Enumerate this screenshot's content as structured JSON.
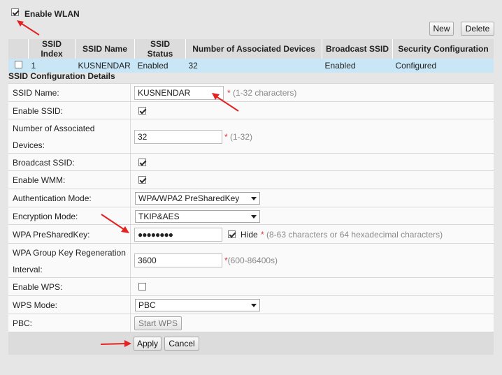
{
  "wlan": {
    "enable_label": "Enable WLAN",
    "enabled": true
  },
  "toolbar": {
    "new_label": "New",
    "delete_label": "Delete"
  },
  "ssid_table": {
    "headers": [
      "SSID Index",
      "SSID Name",
      "SSID Status",
      "Number of Associated Devices",
      "Broadcast SSID",
      "Security Configuration"
    ],
    "rows": [
      {
        "index": "1",
        "name": "KUSNENDAR",
        "status": "Enabled",
        "devices": "32",
        "broadcast": "Enabled",
        "security": "Configured"
      }
    ]
  },
  "details": {
    "title": "SSID Configuration Details",
    "ssid_name": {
      "label": "SSID Name:",
      "value": "KUSNENDAR",
      "hint": "(1-32 characters)"
    },
    "enable_ssid": {
      "label": "Enable SSID:",
      "checked": true
    },
    "assoc_devices": {
      "label_line1": "Number of Associated",
      "label_line2": "Devices:",
      "value": "32",
      "hint": "(1-32)"
    },
    "broadcast_ssid": {
      "label": "Broadcast SSID:",
      "checked": true
    },
    "enable_wmm": {
      "label": "Enable WMM:",
      "checked": true
    },
    "auth_mode": {
      "label": "Authentication Mode:",
      "value": "WPA/WPA2 PreSharedKey"
    },
    "encryption_mode": {
      "label": "Encryption Mode:",
      "value": "TKIP&AES"
    },
    "psk": {
      "label": "WPA PreSharedKey:",
      "value": "●●●●●●●●",
      "hide_label": "Hide",
      "hint": "(8-63 characters or 64 hexadecimal characters)"
    },
    "group_key": {
      "label_line1": "WPA Group Key Regeneration",
      "label_line2": "Interval:",
      "value": "3600",
      "hint": "(600-86400s)"
    },
    "enable_wps": {
      "label": "Enable WPS:",
      "checked": false
    },
    "wps_mode": {
      "label": "WPS Mode:",
      "value": "PBC"
    },
    "pbc": {
      "label": "PBC:",
      "button": "Start WPS"
    }
  },
  "actions": {
    "apply_label": "Apply",
    "cancel_label": "Cancel"
  },
  "colors": {
    "annotation_arrow": "#e32222",
    "row_highlight": "#c9e6f7",
    "required_star": "#dd3333"
  }
}
